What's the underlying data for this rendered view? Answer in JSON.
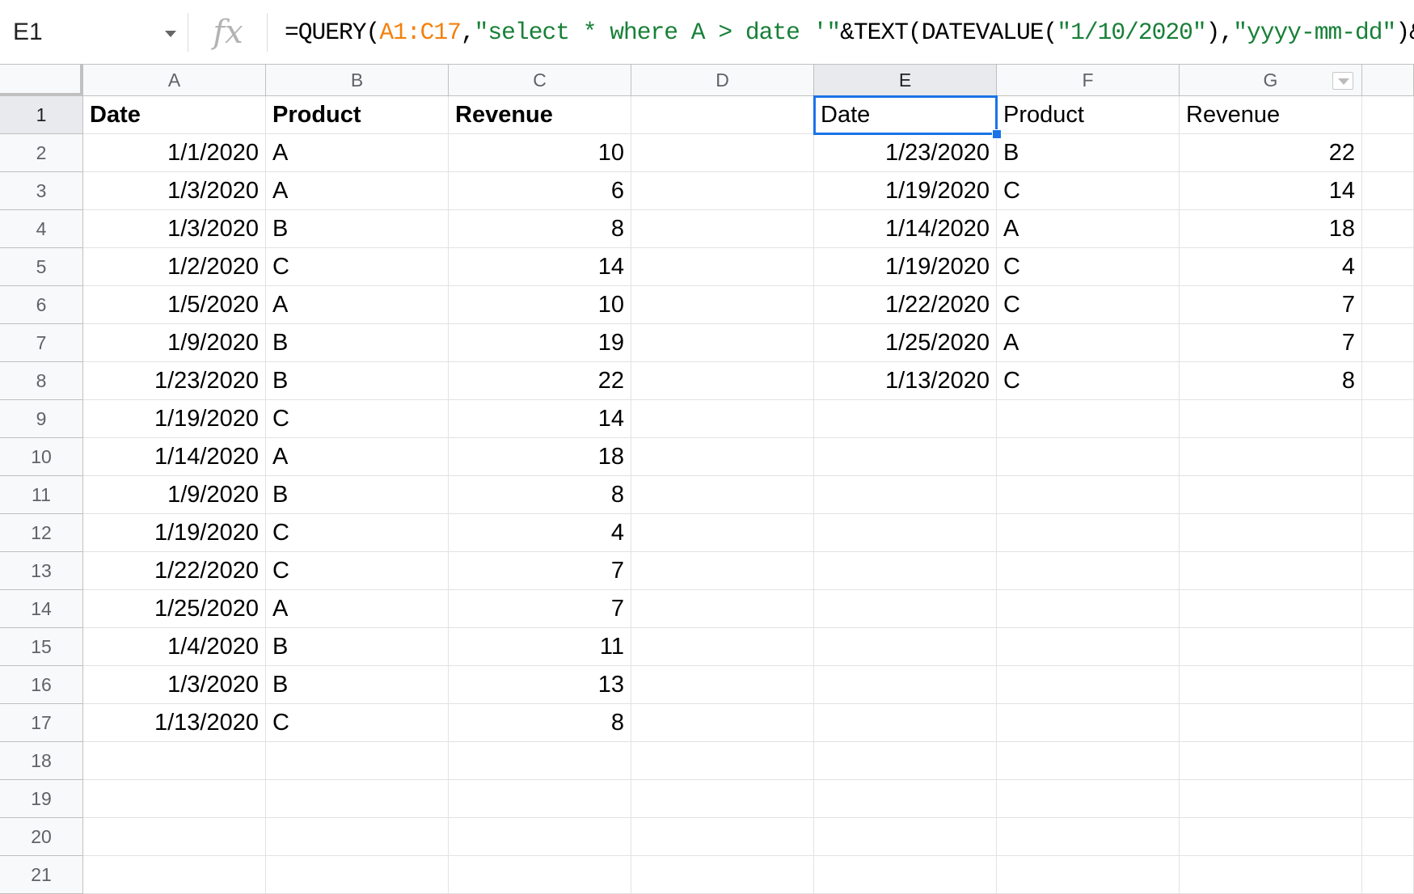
{
  "name_box": "E1",
  "fx_label": "fx",
  "formula": [
    {
      "t": "=QUERY(",
      "k": "plain"
    },
    {
      "t": "A1:C17",
      "k": "ref"
    },
    {
      "t": ",",
      "k": "plain"
    },
    {
      "t": "\"select * where A > date '\"",
      "k": "str"
    },
    {
      "t": "&TEXT(DATEVALUE(",
      "k": "plain"
    },
    {
      "t": "\"1/10/2020\"",
      "k": "str"
    },
    {
      "t": "),",
      "k": "plain"
    },
    {
      "t": "\"yyyy-mm-dd\"",
      "k": "str"
    },
    {
      "t": ")&",
      "k": "plain"
    },
    {
      "t": "\"'\"",
      "k": "str"
    },
    {
      "t": ")",
      "k": "plain"
    }
  ],
  "columns": [
    "A",
    "B",
    "C",
    "D",
    "E",
    "F",
    "G"
  ],
  "selected_column": "E",
  "selected_row": "1",
  "selected_cell": "E1",
  "rows": [
    "1",
    "2",
    "3",
    "4",
    "5",
    "6",
    "7",
    "8",
    "9",
    "10",
    "11",
    "12",
    "13",
    "14",
    "15",
    "16",
    "17",
    "18",
    "19",
    "20",
    "21"
  ],
  "source_table": {
    "headers": [
      "Date",
      "Product",
      "Revenue"
    ],
    "rows": [
      [
        "1/1/2020",
        "A",
        "10"
      ],
      [
        "1/3/2020",
        "A",
        "6"
      ],
      [
        "1/3/2020",
        "B",
        "8"
      ],
      [
        "1/2/2020",
        "C",
        "14"
      ],
      [
        "1/5/2020",
        "A",
        "10"
      ],
      [
        "1/9/2020",
        "B",
        "19"
      ],
      [
        "1/23/2020",
        "B",
        "22"
      ],
      [
        "1/19/2020",
        "C",
        "14"
      ],
      [
        "1/14/2020",
        "A",
        "18"
      ],
      [
        "1/9/2020",
        "B",
        "8"
      ],
      [
        "1/19/2020",
        "C",
        "4"
      ],
      [
        "1/22/2020",
        "C",
        "7"
      ],
      [
        "1/25/2020",
        "A",
        "7"
      ],
      [
        "1/4/2020",
        "B",
        "11"
      ],
      [
        "1/3/2020",
        "B",
        "13"
      ],
      [
        "1/13/2020",
        "C",
        "8"
      ]
    ]
  },
  "query_result": {
    "headers": [
      "Date",
      "Product",
      "Revenue"
    ],
    "rows": [
      [
        "1/23/2020",
        "B",
        "22"
      ],
      [
        "1/19/2020",
        "C",
        "14"
      ],
      [
        "1/14/2020",
        "A",
        "18"
      ],
      [
        "1/19/2020",
        "C",
        "4"
      ],
      [
        "1/22/2020",
        "C",
        "7"
      ],
      [
        "1/25/2020",
        "A",
        "7"
      ],
      [
        "1/13/2020",
        "C",
        "8"
      ]
    ]
  }
}
